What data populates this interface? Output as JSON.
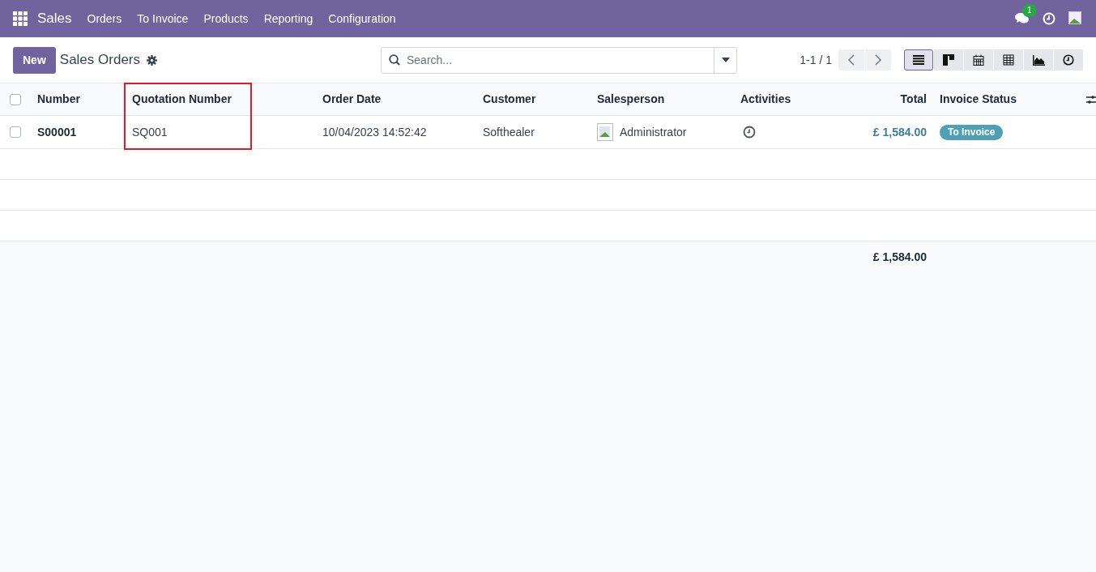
{
  "navbar": {
    "app": "Sales",
    "menu": [
      "Orders",
      "To Invoice",
      "Products",
      "Reporting",
      "Configuration"
    ],
    "message_count": "1"
  },
  "control_panel": {
    "new_button": "New",
    "title": "Sales Orders",
    "search": {
      "placeholder": "Search..."
    },
    "pager": "1-1 / 1",
    "views": [
      {
        "kind": "list",
        "selected": true
      },
      {
        "kind": "kanban",
        "selected": false
      },
      {
        "kind": "calendar",
        "selected": false
      },
      {
        "kind": "pivot",
        "selected": false
      },
      {
        "kind": "graph",
        "selected": false
      },
      {
        "kind": "activity",
        "selected": false
      }
    ]
  },
  "table": {
    "select_all_checked": false,
    "columns": [
      {
        "label": "Number",
        "highlighted": false
      },
      {
        "label": "Quotation Number",
        "highlighted": true
      },
      {
        "label": "Order Date",
        "highlighted": false
      },
      {
        "label": "Customer",
        "highlighted": false
      },
      {
        "label": "Salesperson",
        "highlighted": false
      },
      {
        "label": "Activities",
        "highlighted": false
      },
      {
        "label": "Total",
        "highlighted": false
      },
      {
        "label": "Invoice Status",
        "highlighted": false
      }
    ],
    "rows": [
      {
        "checked": false,
        "number": "S00001",
        "quotation_number": "SQ001",
        "order_date": "10/04/2023 14:52:42",
        "customer": "Softhealer",
        "salesperson": "Administrator",
        "total": "£ 1,584.00",
        "invoice_status": "To Invoice"
      }
    ],
    "footer_total": "£ 1,584.00"
  }
}
